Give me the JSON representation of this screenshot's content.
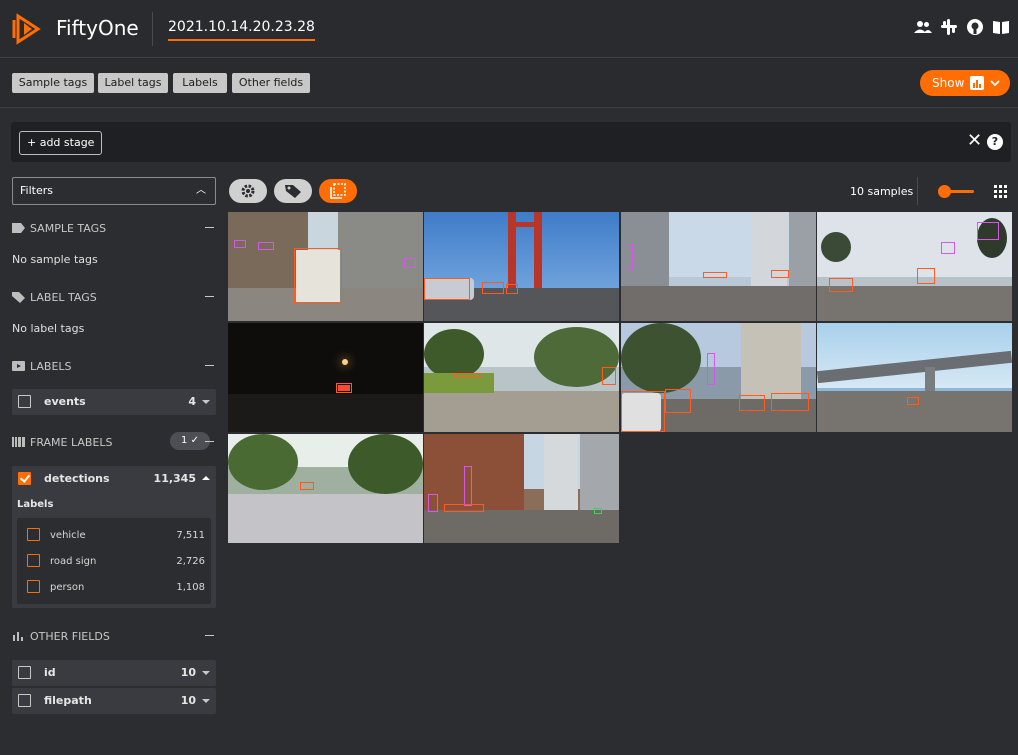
{
  "header": {
    "app_name": "FiftyOne",
    "dataset_name": "2021.10.14.20.23.28",
    "icons": [
      "team-icon",
      "slack-icon",
      "github-icon",
      "docs-icon"
    ],
    "accent_color": "#ff6d04"
  },
  "tabs": [
    "Sample tags",
    "Label tags",
    "Labels",
    "Other fields"
  ],
  "show_button": {
    "label": "Show"
  },
  "stage_bar": {
    "add_stage_label": "+ add stage"
  },
  "sidebar": {
    "filters_label": "Filters",
    "sample_tags": {
      "title": "SAMPLE TAGS",
      "empty": "No sample tags"
    },
    "label_tags": {
      "title": "LABEL TAGS",
      "empty": "No label tags"
    },
    "labels": {
      "title": "LABELS",
      "fields": [
        {
          "name": "events",
          "count": "4"
        }
      ]
    },
    "frame_labels": {
      "title": "FRAME LABELS",
      "badge": "1 ✓",
      "field": {
        "name": "detections",
        "count": "11,345"
      },
      "sub_title": "Labels",
      "classes": [
        {
          "name": "vehicle",
          "count": "7,511"
        },
        {
          "name": "road sign",
          "count": "2,726"
        },
        {
          "name": "person",
          "count": "1,108"
        }
      ]
    },
    "other_fields": {
      "title": "OTHER FIELDS",
      "fields": [
        {
          "name": "id",
          "count": "10"
        },
        {
          "name": "filepath",
          "count": "10"
        }
      ]
    }
  },
  "grid": {
    "sample_count": "10 samples",
    "tiles": 10
  }
}
